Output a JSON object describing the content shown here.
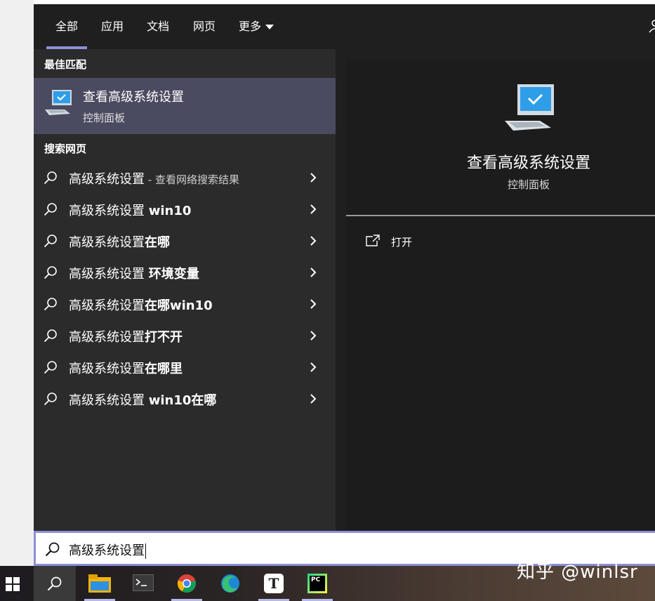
{
  "tabs": [
    {
      "label": "全部"
    },
    {
      "label": "应用"
    },
    {
      "label": "文档"
    },
    {
      "label": "网页"
    },
    {
      "label": "更多"
    }
  ],
  "best_match": {
    "section_title": "最佳匹配",
    "title": "查看高级系统设置",
    "subtitle": "控制面板"
  },
  "web_search": {
    "section_title": "搜索网页",
    "items": [
      {
        "base": "高级系统设置",
        "bold": "",
        "suffix": " - 查看网络搜索结果"
      },
      {
        "base": "高级系统设置 ",
        "bold": "win10",
        "suffix": ""
      },
      {
        "base": "高级系统设置",
        "bold": "在哪",
        "suffix": ""
      },
      {
        "base": "高级系统设置 ",
        "bold": "环境变量",
        "suffix": ""
      },
      {
        "base": "高级系统设置",
        "bold": "在哪win10",
        "suffix": ""
      },
      {
        "base": "高级系统设置",
        "bold": "打不开",
        "suffix": ""
      },
      {
        "base": "高级系统设置",
        "bold": "在哪里",
        "suffix": ""
      },
      {
        "base": "高级系统设置 ",
        "bold": "win10在哪",
        "suffix": ""
      }
    ]
  },
  "detail": {
    "title": "查看高级系统设置",
    "subtitle": "控制面板",
    "open_label": "打开"
  },
  "search": {
    "query": "高级系统设置"
  },
  "taskbar": {
    "icons": [
      "windows-start-icon",
      "search-icon",
      "file-explorer-icon",
      "terminal-icon",
      "chrome-icon",
      "edge-icon",
      "typora-icon",
      "pycharm-icon"
    ]
  },
  "watermark": "知乎 @winlsr",
  "colors": {
    "accent": "#8b8fd6",
    "panel_bg": "#2b2b2b",
    "header_bg": "#1f1f1f",
    "selected_bg": "#4a4a60"
  }
}
